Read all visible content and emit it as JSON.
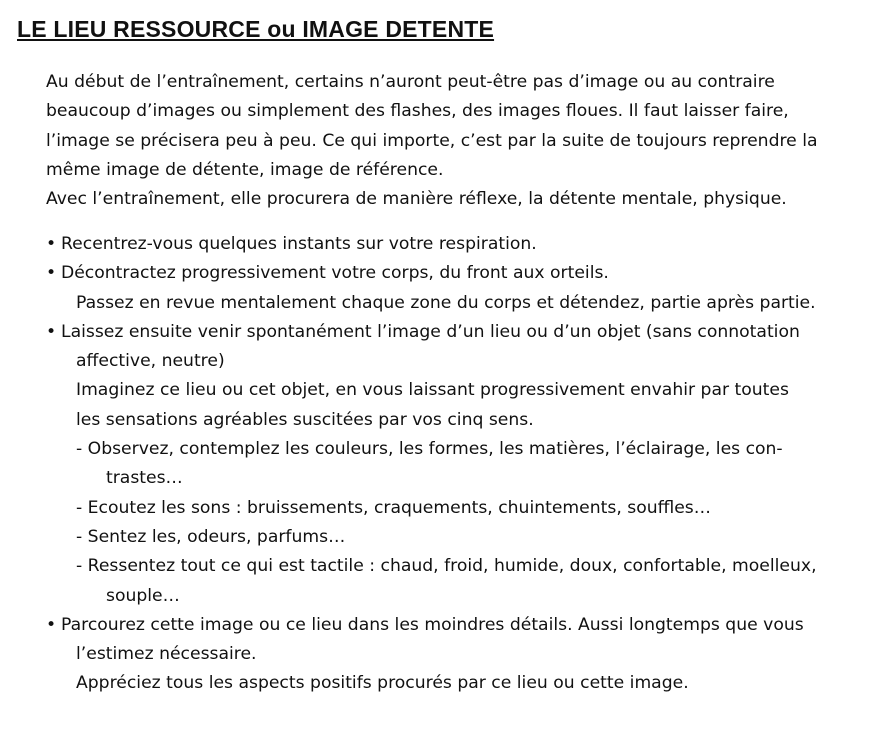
{
  "title": "LE LIEU RESSOURCE ou IMAGE DETENTE",
  "intro": [
    "Au début de l’entraînement, certains n’auront peut-être pas d’image ou au contraire",
    "beaucoup d’images ou simplement des flashes, des images floues. Il faut laisser faire,",
    "l’image se précisera peu à peu. Ce qui importe, c’est par la suite de toujours reprendre la",
    "même image de détente, image de référence.",
    "Avec l’entraînement, elle procurera de manière réflexe, la détente mentale, physique."
  ],
  "bullet_char": "•",
  "lines": [
    "Recentrez-vous quelques  instants sur votre respiration.",
    "Décontractez progressivement votre corps, du front aux orteils.",
    "Passez en revue mentalement chaque zone du corps  et détendez, partie après partie.",
    "Laissez ensuite venir spontanément l’image d’un lieu ou d’un objet (sans connotation",
    "affective, neutre)",
    "Imaginez ce lieu ou cet objet, en vous laissant progressivement envahir par toutes",
    "les sensations agréables suscitées par vos cinq sens.",
    "- Observez, contemplez les couleurs, les formes, les matières, l’éclairage, les con-",
    "trastes…",
    "- Ecoutez les sons : bruissements, craquements, chuintements, souffles…",
    "- Sentez les, odeurs, parfums…",
    "- Ressentez tout ce qui est tactile : chaud, froid, humide, doux, confortable, moelleux,",
    "souple…",
    "Parcourez cette image ou ce lieu dans les moindres détails. Aussi longtemps que vous",
    "l’estimez nécessaire.",
    "Appréciez  tous les aspects positifs procurés par ce lieu ou cette  image."
  ]
}
